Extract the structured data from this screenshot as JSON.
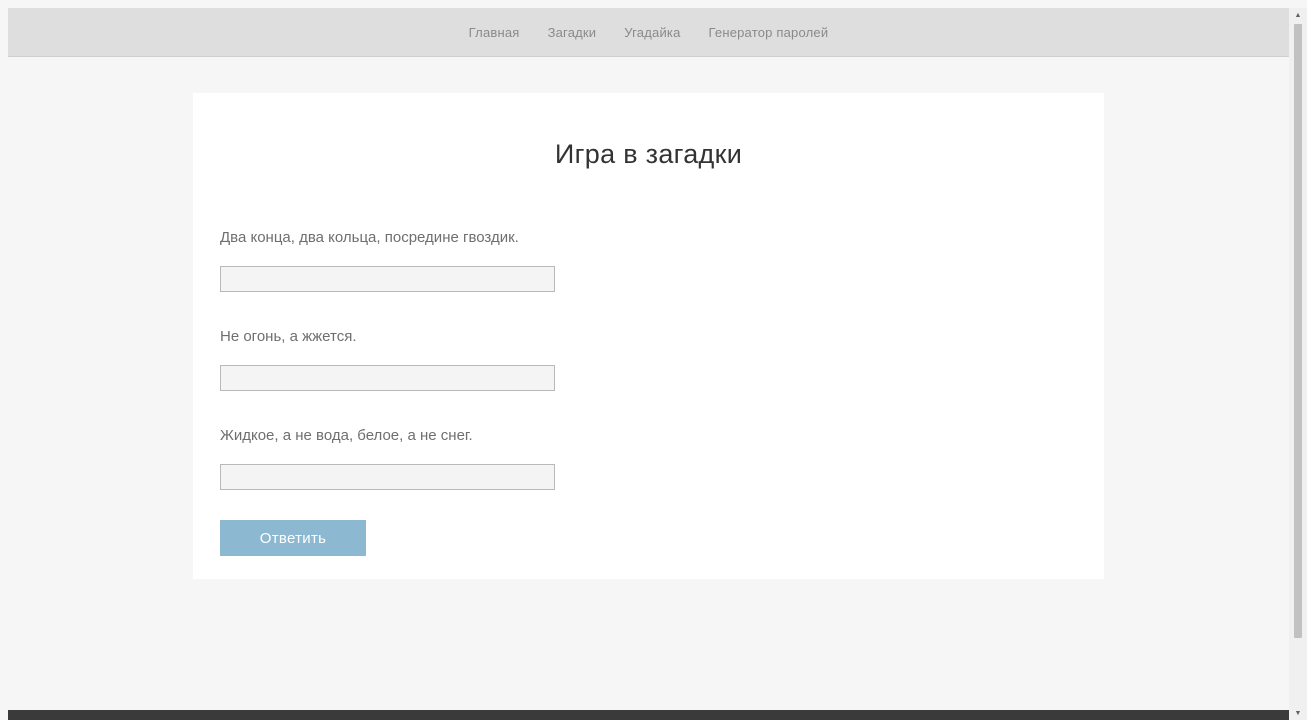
{
  "nav": {
    "items": [
      {
        "label": "Главная"
      },
      {
        "label": "Загадки"
      },
      {
        "label": "Угадайка"
      },
      {
        "label": "Генератор паролей"
      }
    ]
  },
  "main": {
    "title": "Игра в загадки",
    "riddles": [
      {
        "question": "Два конца, два кольца, посредине гвоздик.",
        "answer": ""
      },
      {
        "question": "Не огонь, а жжется.",
        "answer": ""
      },
      {
        "question": "Жидкое, а не вода, белое, а не снег.",
        "answer": ""
      }
    ],
    "submit_label": "Ответить"
  },
  "scrollbar": {
    "up_icon": "▲",
    "down_icon": "▼"
  }
}
